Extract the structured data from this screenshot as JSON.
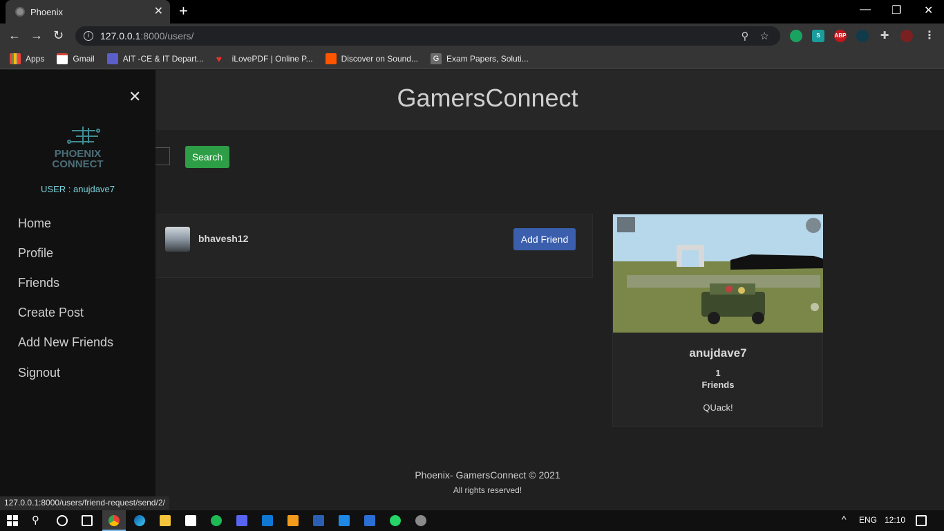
{
  "browser": {
    "tab_title": "Phoenix",
    "tab_close": "✕",
    "new_tab": "+",
    "url_host": "127.0.0.1",
    "url_path": ":8000/users/",
    "bookmarks": [
      {
        "label": "Apps",
        "color": "#e8453c"
      },
      {
        "label": "Gmail",
        "color": "#d44638"
      },
      {
        "label": "AIT -CE & IT Depart...",
        "color": "#5b5fc7"
      },
      {
        "label": "iLovePDF | Online P...",
        "color": "#e5322d"
      },
      {
        "label": "Discover on Sound...",
        "color": "#ff5500"
      },
      {
        "label": "Exam Papers, Soluti...",
        "color": "#6b6b6b"
      }
    ],
    "status_url": "127.0.0.1:8000/users/friend-request/send/2/"
  },
  "site": {
    "title": "GamersConnect",
    "search_button": "Search",
    "users": [
      {
        "username": "bhavesh12",
        "action": "Add Friend"
      }
    ],
    "profile": {
      "username": "anujdave7",
      "friend_count": "1",
      "friends_label": "Friends",
      "bio": "QUack!"
    },
    "footer": {
      "line1": "Phoenix- GamersConnect © 2021",
      "line2": "All rights reserved!"
    }
  },
  "sidebar": {
    "close": "✕",
    "logo_line1": "PHOENIX",
    "logo_line2": "CONNECT",
    "user_label": "USER : anujdave7",
    "items": [
      {
        "label": "Home"
      },
      {
        "label": "Profile"
      },
      {
        "label": "Friends"
      },
      {
        "label": "Create Post"
      },
      {
        "label": "Add New Friends"
      },
      {
        "label": "Signout"
      }
    ]
  },
  "taskbar": {
    "language": "ENG",
    "time": "12:10"
  }
}
